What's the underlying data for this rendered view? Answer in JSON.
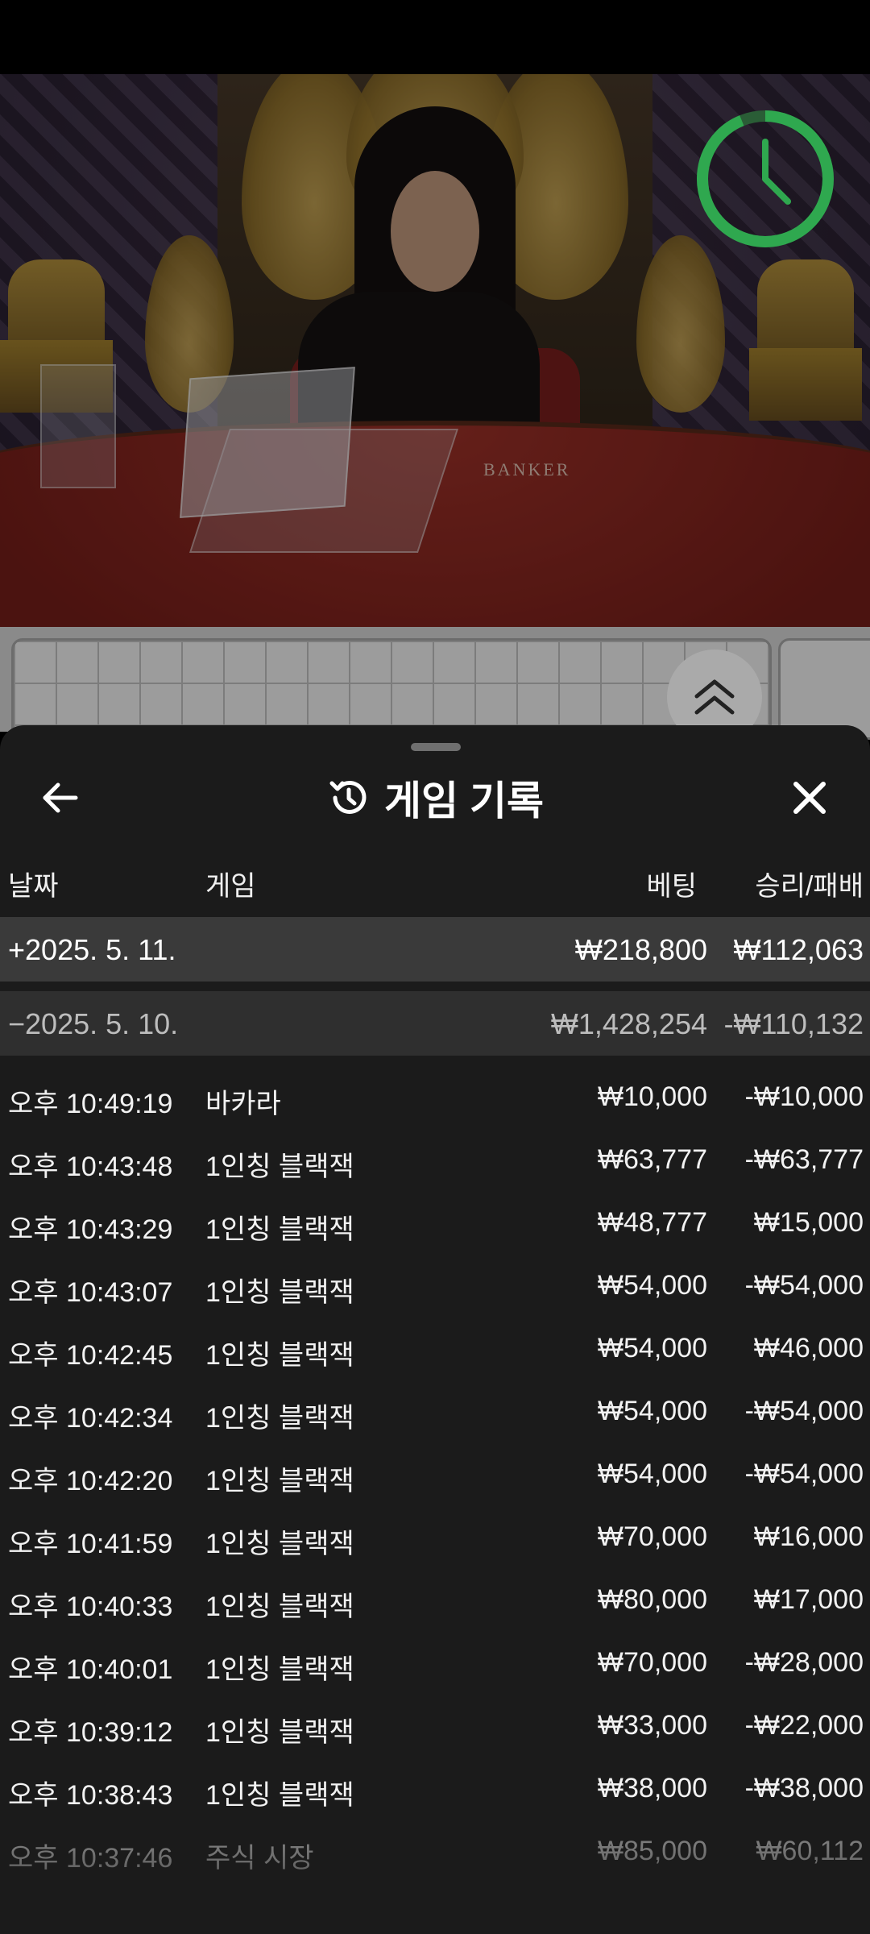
{
  "video": {
    "table_label": "BANKER"
  },
  "sheet": {
    "title": "게임 기록",
    "back_icon": "arrow-left-icon",
    "close_icon": "close-icon",
    "history_icon": "history-clock-icon",
    "columns": {
      "date": "날짜",
      "game": "게임",
      "bet": "베팅",
      "result": "승리/패배"
    },
    "days": [
      {
        "label": "+2025. 5. 11.",
        "bet": "₩218,800",
        "result": "₩112,063",
        "expanded": false
      },
      {
        "label": "−2025. 5. 10.",
        "bet": "₩1,428,254",
        "result": "-₩110,132",
        "expanded": true
      }
    ],
    "rows": [
      {
        "time": "오후 10:49:19",
        "game": "바카라",
        "bet": "₩10,000",
        "result": "-₩10,000"
      },
      {
        "time": "오후 10:43:48",
        "game": "1인칭 블랙잭",
        "bet": "₩63,777",
        "result": "-₩63,777"
      },
      {
        "time": "오후 10:43:29",
        "game": "1인칭 블랙잭",
        "bet": "₩48,777",
        "result": "₩15,000"
      },
      {
        "time": "오후 10:43:07",
        "game": "1인칭 블랙잭",
        "bet": "₩54,000",
        "result": "-₩54,000"
      },
      {
        "time": "오후 10:42:45",
        "game": "1인칭 블랙잭",
        "bet": "₩54,000",
        "result": "₩46,000"
      },
      {
        "time": "오후 10:42:34",
        "game": "1인칭 블랙잭",
        "bet": "₩54,000",
        "result": "-₩54,000"
      },
      {
        "time": "오후 10:42:20",
        "game": "1인칭 블랙잭",
        "bet": "₩54,000",
        "result": "-₩54,000"
      },
      {
        "time": "오후 10:41:59",
        "game": "1인칭 블랙잭",
        "bet": "₩70,000",
        "result": "₩16,000"
      },
      {
        "time": "오후 10:40:33",
        "game": "1인칭 블랙잭",
        "bet": "₩80,000",
        "result": "₩17,000"
      },
      {
        "time": "오후 10:40:01",
        "game": "1인칭 블랙잭",
        "bet": "₩70,000",
        "result": "-₩28,000"
      },
      {
        "time": "오후 10:39:12",
        "game": "1인칭 블랙잭",
        "bet": "₩33,000",
        "result": "-₩22,000"
      },
      {
        "time": "오후 10:38:43",
        "game": "1인칭 블랙잭",
        "bet": "₩38,000",
        "result": "-₩38,000"
      },
      {
        "time": "오후 10:37:46",
        "game": "주식 시장",
        "bet": "₩85,000",
        "result": "₩60,112"
      }
    ]
  },
  "colors": {
    "sheet_bg": "#1b1b1b",
    "day_row_bg": "#3a3a3a",
    "timer_green": "#2fa84f",
    "table_red": "#7a1f1a"
  }
}
